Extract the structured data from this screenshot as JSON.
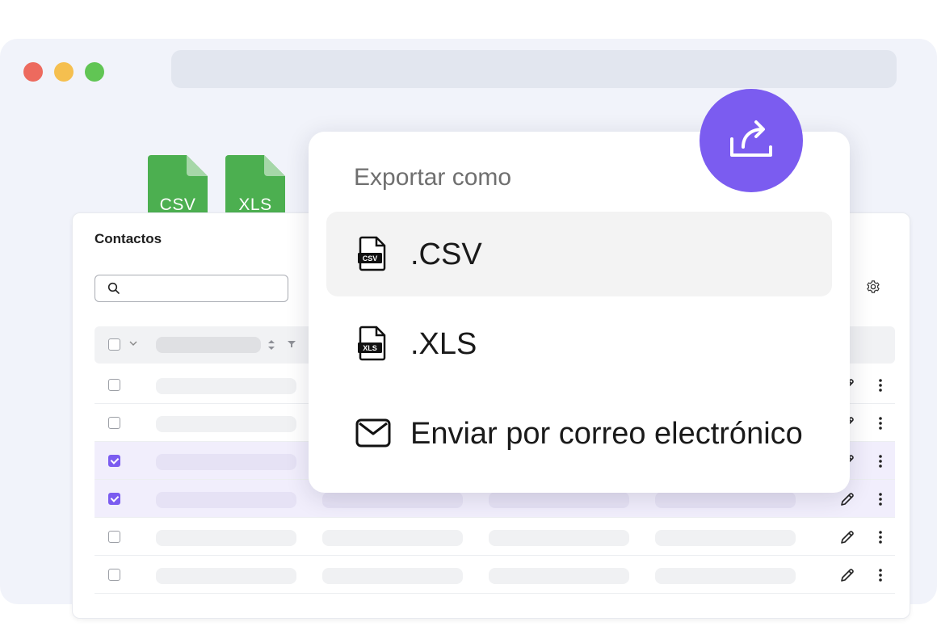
{
  "window": {
    "controls": [
      "close",
      "minimize",
      "maximize"
    ]
  },
  "files": [
    {
      "label": "CSV",
      "color": "#4caf50"
    },
    {
      "label": "XLS",
      "color": "#4caf50"
    }
  ],
  "contacts": {
    "title": "Contactos",
    "search": {
      "placeholder": "",
      "icon": "search-icon"
    },
    "settings_icon": "gear-icon",
    "rows": [
      {
        "selected": false
      },
      {
        "selected": false
      },
      {
        "selected": true
      },
      {
        "selected": true
      },
      {
        "selected": false
      },
      {
        "selected": false
      }
    ]
  },
  "export_menu": {
    "title": "Exportar como",
    "options": [
      {
        "label": ".CSV",
        "icon": "csv-file-icon",
        "badge": "CSV",
        "highlighted": true
      },
      {
        "label": ".XLS",
        "icon": "xls-file-icon",
        "badge": "XLS",
        "highlighted": false
      },
      {
        "label": "Enviar por correo electrónico",
        "icon": "mail-icon",
        "highlighted": false
      }
    ],
    "action_icon": "share-export-icon"
  },
  "colors": {
    "accent": "#7b5cf0",
    "file_green": "#4caf50",
    "selected_row": "#f1eefc"
  }
}
